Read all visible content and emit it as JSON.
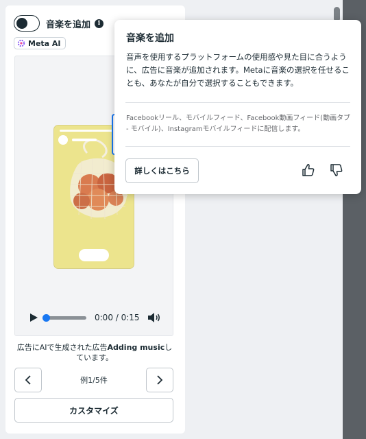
{
  "music_toggle": {
    "label": "音楽を追加",
    "on": false
  },
  "meta_ai_badge": {
    "label": "Meta AI"
  },
  "player": {
    "time": "0:00 / 0:15",
    "progress": 0.0
  },
  "caption": {
    "prefix": "広告にAIで生成された広告",
    "bold": "Adding music",
    "suffix": "しています。"
  },
  "pager": {
    "counter": "例1/5件"
  },
  "customize_button": {
    "label": "カスタマイズ"
  },
  "popover": {
    "title": "音楽を追加",
    "body": "音声を使用するプラットフォームの使用感や見た目に合うように、広告に音楽が追加されます。Metaに音楽の選択を任せることも、あなたが自分で選択することもできます。",
    "note": "Facebookリール、モバイルフィード、Facebook動画フィード(動画タブ - モバイル)、Instagramモバイルフィードに配信します。",
    "learn_more": "詳しくはこちら"
  },
  "colors": {
    "accent": "#1877f2",
    "text": "#1c2b33",
    "background": "#eef0f3"
  },
  "icons": [
    "info-icon",
    "meta-ai-spark-icon",
    "play-icon",
    "volume-icon",
    "chevron-left-icon",
    "chevron-right-icon",
    "thumbs-up-icon",
    "thumbs-down-icon"
  ]
}
